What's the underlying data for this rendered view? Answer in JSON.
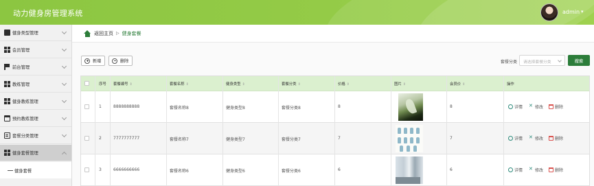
{
  "header": {
    "app_title": "动力健身房管理系统",
    "user_name": "admin",
    "user_caret": "▾",
    "brand_color": "#8cc641"
  },
  "sidebar": {
    "items": [
      {
        "label": "健身类型管理",
        "icon": "film-icon"
      },
      {
        "label": "会员管理",
        "icon": "grid-icon"
      },
      {
        "label": "前台管理",
        "icon": "flag-icon"
      },
      {
        "label": "教练管理",
        "icon": "grid-icon"
      },
      {
        "label": "健身教练管理",
        "icon": "grid-icon"
      },
      {
        "label": "预约教练管理",
        "icon": "calendar-icon"
      },
      {
        "label": "套餐分类管理",
        "icon": "document-icon"
      },
      {
        "label": "健身套餐管理",
        "icon": "grid-icon"
      }
    ],
    "active_sub": "健身套餐"
  },
  "breadcrumb": {
    "home": "返回主页",
    "separator": "▷",
    "current": "健身套餐"
  },
  "toolbar": {
    "add_label": "新增",
    "delete_label": "删除",
    "search_label": "套餐分类",
    "search_placeholder": "请选择套餐分类",
    "search_button": "搜索"
  },
  "table": {
    "headers": {
      "index": "序号",
      "code": "套餐编号",
      "name": "套餐名称",
      "type": "健身类型",
      "category": "套餐分类",
      "price": "价格",
      "image": "图片",
      "member_price": "会员价",
      "actions": "操作"
    },
    "sort_glyph": "⇕",
    "rows": [
      {
        "index": "1",
        "code": "8888888888",
        "name": "套餐名称8",
        "type": "健身类型8",
        "category": "套餐分类8",
        "price": "8",
        "image": "plant-photo",
        "member_price": "8"
      },
      {
        "index": "2",
        "code": "7777777777",
        "name": "套餐名称7",
        "type": "健身类型7",
        "category": "套餐分类7",
        "price": "7",
        "image": "exercise-figures",
        "member_price": "7"
      },
      {
        "index": "3",
        "code": "6666666666",
        "name": "套餐名称6",
        "type": "健身类型6",
        "category": "套餐分类6",
        "price": "6",
        "image": "room-photo",
        "member_price": "6"
      }
    ],
    "actions": {
      "detail": "详情",
      "edit": "修改",
      "delete": "删除"
    },
    "header_bg": "#dbf0cf"
  }
}
